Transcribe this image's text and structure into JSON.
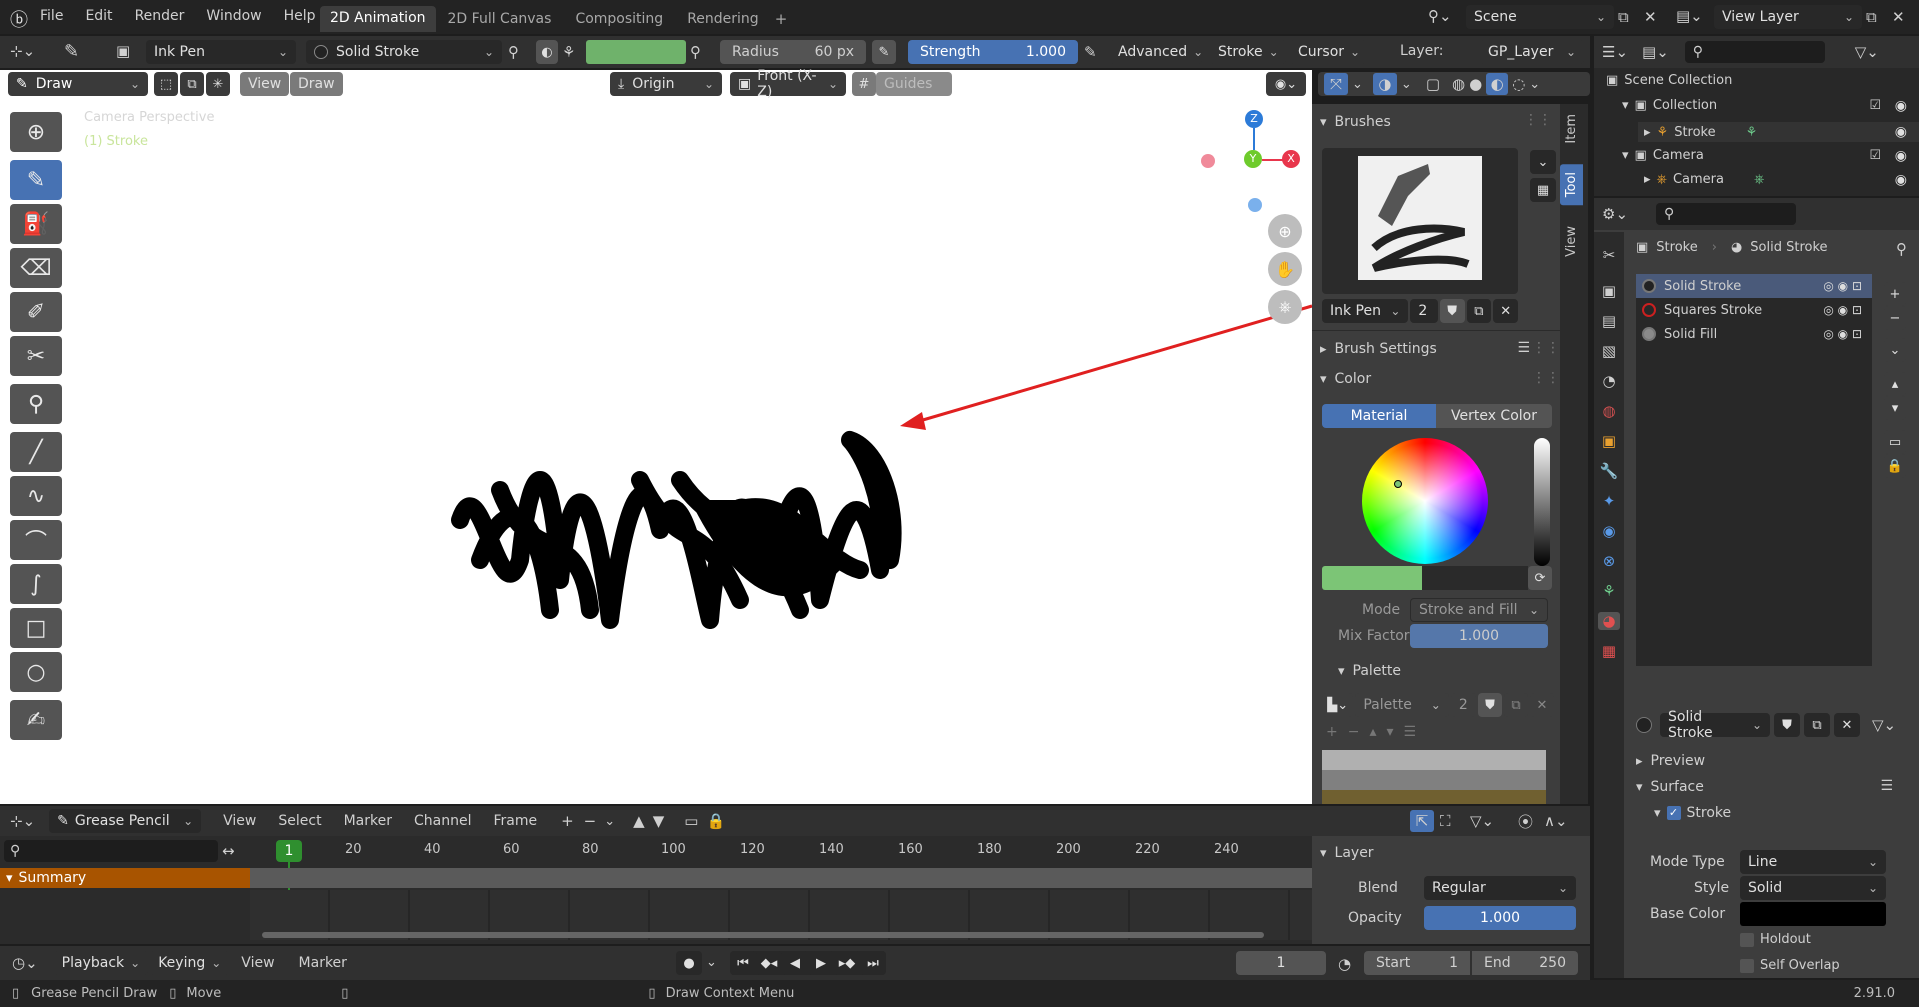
{
  "topbar": {
    "menus": [
      "File",
      "Edit",
      "Render",
      "Window",
      "Help"
    ],
    "workspaces": [
      "2D Animation",
      "2D Full Canvas",
      "Compositing",
      "Rendering"
    ],
    "scene": "Scene",
    "view_layer": "View Layer"
  },
  "toolheader": {
    "brush_name": "Ink Pen",
    "material": "Solid Stroke",
    "radius_label": "Radius",
    "radius_value": "60 px",
    "strength_label": "Strength",
    "strength_value": "1.000",
    "advanced": "Advanced",
    "stroke": "Stroke",
    "cursor": "Cursor",
    "layer_label": "Layer:",
    "layer_value": "GP_Layer"
  },
  "viewport_header": {
    "mode": "Draw",
    "view": "View",
    "draw": "Draw",
    "origin": "Origin",
    "projection": "Front (X-Z)",
    "guides": "Guides"
  },
  "viewport": {
    "overlay_line1": "Camera Perspective",
    "overlay_line2": "(1) Stroke",
    "axis_z": "Z",
    "axis_y": "Y",
    "axis_x": "X"
  },
  "side_tabs": [
    "Item",
    "Tool",
    "View"
  ],
  "brushes_panel": {
    "title": "Brushes",
    "brush_name": "Ink Pen",
    "brush_users": "2",
    "brush_settings": "Brush Settings",
    "color_title": "Color",
    "tab_material": "Material",
    "tab_vertex": "Vertex Color",
    "mode_label": "Mode",
    "mode_value": "Stroke and Fill",
    "mix_label": "Mix Factor",
    "mix_value": "1.000",
    "palette_title": "Palette",
    "palette_name": "Palette",
    "palette_users": "2",
    "active_color": "#7cc576"
  },
  "outliner": {
    "scene_collection": "Scene Collection",
    "collection": "Collection",
    "stroke": "Stroke",
    "camera_collection": "Camera",
    "camera": "Camera"
  },
  "properties": {
    "breadcrumb_object": "Stroke",
    "breadcrumb_material": "Solid Stroke",
    "materials": [
      {
        "name": "Solid Stroke",
        "swatch": "#222222"
      },
      {
        "name": "Squares Stroke",
        "swatch": "#cc2020"
      },
      {
        "name": "Solid Fill",
        "swatch": "#8a8a8a"
      }
    ],
    "material_field": "Solid Stroke",
    "preview": "Preview",
    "surface": "Surface",
    "stroke_section": "Stroke",
    "mode_type_label": "Mode Type",
    "mode_type_value": "Line",
    "style_label": "Style",
    "style_value": "Solid",
    "base_color_label": "Base Color",
    "base_color": "#000000",
    "holdout": "Holdout",
    "self_overlap": "Self Overlap"
  },
  "timeline": {
    "editor": "Grease Pencil",
    "menus": [
      "View",
      "Select",
      "Marker",
      "Channel",
      "Frame"
    ],
    "ruler": [
      "1",
      "20",
      "40",
      "60",
      "80",
      "100",
      "120",
      "140",
      "160",
      "180",
      "200",
      "220",
      "240"
    ],
    "summary": "Summary",
    "layer_title": "Layer",
    "blend_label": "Blend",
    "blend_value": "Regular",
    "opacity_label": "Opacity",
    "opacity_value": "1.000"
  },
  "playback": {
    "playback": "Playback",
    "keying": "Keying",
    "view": "View",
    "marker": "Marker",
    "current_frame": "1",
    "start_label": "Start",
    "start_value": "1",
    "end_label": "End",
    "end_value": "250"
  },
  "statusbar": {
    "left1": "Grease Pencil Draw",
    "left2": "Move",
    "center": "Draw Context Menu",
    "version": "2.91.0"
  }
}
